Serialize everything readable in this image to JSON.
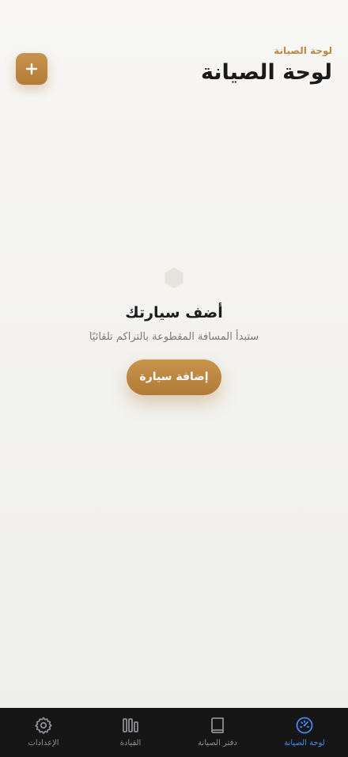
{
  "header": {
    "eyebrow": "لوحة الصيانة",
    "title": "لوحة الصيانة",
    "add_icon": "plus-icon"
  },
  "empty_state": {
    "icon": "hexagon-icon",
    "title": "أضف سيارتك",
    "subtitle": "ستبدأ المسافة المقطوعة بالتراكم تلقائيًا",
    "button_label": "إضافة سيارة"
  },
  "tab_bar": {
    "tabs": [
      {
        "label": "لوحة الصيانة",
        "icon": "gauge-icon",
        "active": true
      },
      {
        "label": "دفتر الصيانة",
        "icon": "book-icon",
        "active": false
      },
      {
        "label": "القيادة",
        "icon": "bars-icon",
        "active": false
      },
      {
        "label": "الإعدادات",
        "icon": "gear-icon",
        "active": false
      }
    ]
  },
  "colors": {
    "accent": "#b98a45",
    "tab_active": "#3d8bf2",
    "tab_inactive": "#8e8e93",
    "tab_bar_bg": "#161616"
  }
}
